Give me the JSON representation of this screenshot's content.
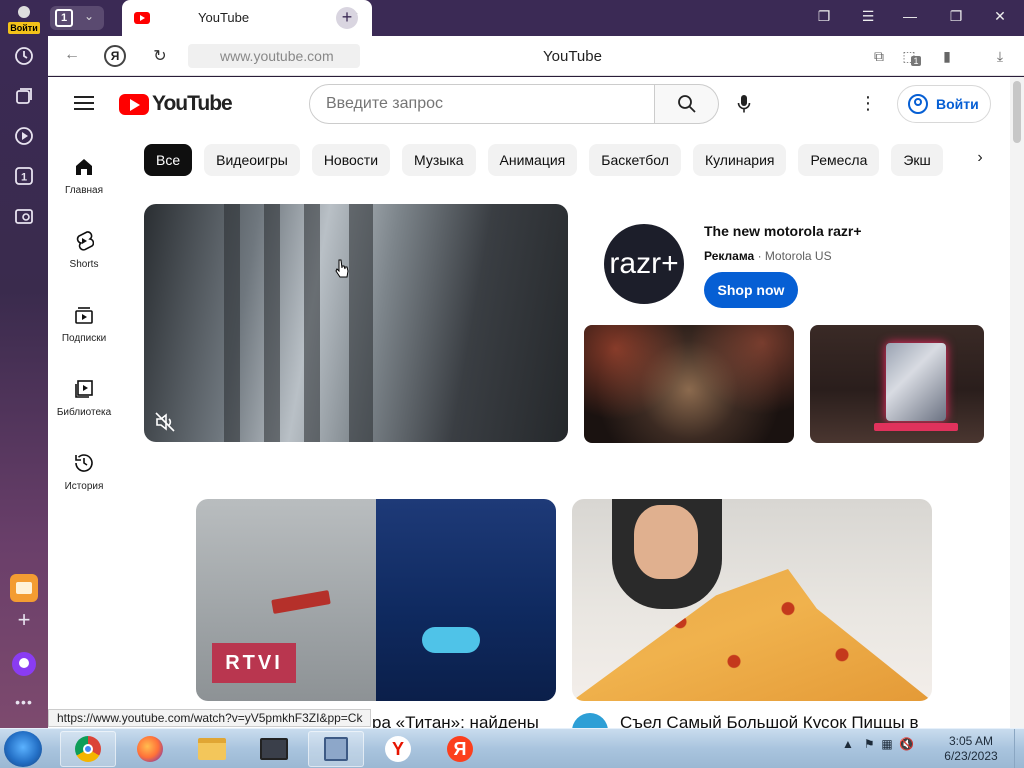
{
  "browser": {
    "login_label": "Войти",
    "tab_count": "1",
    "tab_title": "YouTube",
    "url": "www.youtube.com",
    "page_title": "YouTube",
    "alice_badge": "1",
    "window_controls": [
      "bookmark-tabs-icon",
      "menu-icon",
      "minimize-icon",
      "restore-icon",
      "close-icon"
    ]
  },
  "rail": {
    "items": [
      "history-icon",
      "collections-icon",
      "media-icon",
      "tab-counter-icon",
      "screenshot-icon"
    ],
    "tab_counter": "1"
  },
  "youtube": {
    "logo_text": "YouTube",
    "search_placeholder": "Введите запрос",
    "signin_label": "Войти",
    "guide": [
      {
        "label": "Главная",
        "icon": "home-icon"
      },
      {
        "label": "Shorts",
        "icon": "shorts-icon"
      },
      {
        "label": "Подписки",
        "icon": "subscriptions-icon"
      },
      {
        "label": "Библиотека",
        "icon": "library-icon"
      },
      {
        "label": "История",
        "icon": "history-icon"
      }
    ],
    "chips": [
      "Все",
      "Видеоигры",
      "Новости",
      "Музыка",
      "Анимация",
      "Баскетбол",
      "Кулинария",
      "Ремесла",
      "Экш"
    ],
    "ad": {
      "logo_text": "razr+",
      "title": "The new motorola razr+",
      "sponsored": "Реклама",
      "advertiser": "Motorola US",
      "cta": "Shop now"
    },
    "videos": [
      {
        "badge": "RTVI",
        "title": "ра «Титан»: найдены"
      },
      {
        "title": "Съел Самый Большой Кусок Пиццы в"
      }
    ],
    "status_url": "https://www.youtube.com/watch?v=yV5pmkhF3ZI&pp=Ck"
  },
  "taskbar": {
    "apps": [
      "chrome-icon",
      "firefox-icon",
      "explorer-folder-icon",
      "tv-app-icon",
      "network-app-icon",
      "yandex-browser-icon",
      "yandex-icon"
    ],
    "time": "3:05 AM",
    "date": "6/23/2023"
  },
  "colors": {
    "brand_red": "#ff0000",
    "link_blue": "#065fd4",
    "rail_purple": "#3b2a55"
  }
}
